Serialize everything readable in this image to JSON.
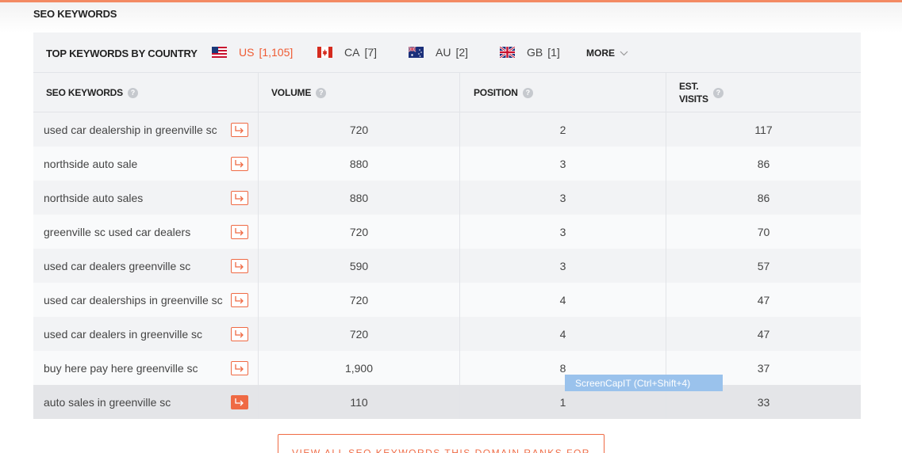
{
  "section_title": "SEO KEYWORDS",
  "country_bar": {
    "label": "TOP KEYWORDS BY COUNTRY",
    "countries": [
      {
        "code": "US",
        "count": "[1,105]",
        "flag": "us-flag-icon"
      },
      {
        "code": "CA",
        "count": "[7]",
        "flag": "ca-flag-icon"
      },
      {
        "code": "AU",
        "count": "[2]",
        "flag": "au-flag-icon"
      },
      {
        "code": "GB",
        "count": "[1]",
        "flag": "gb-flag-icon"
      }
    ],
    "more_label": "MORE"
  },
  "table": {
    "headers": {
      "keywords": "SEO KEYWORDS",
      "volume": "VOLUME",
      "position": "POSITION",
      "visits_line1": "EST.",
      "visits_line2": "VISITS",
      "help_glyph": "?"
    },
    "rows": [
      {
        "keyword": "used car dealership in greenville sc",
        "volume": "720",
        "position": "2",
        "visits": "117"
      },
      {
        "keyword": "northside auto sale",
        "volume": "880",
        "position": "3",
        "visits": "86"
      },
      {
        "keyword": "northside auto sales",
        "volume": "880",
        "position": "3",
        "visits": "86"
      },
      {
        "keyword": "greenville sc used car dealers",
        "volume": "720",
        "position": "3",
        "visits": "70"
      },
      {
        "keyword": "used car dealers greenville sc",
        "volume": "590",
        "position": "3",
        "visits": "57"
      },
      {
        "keyword": "used car dealerships in greenville sc",
        "volume": "720",
        "position": "4",
        "visits": "47"
      },
      {
        "keyword": "used car dealers in greenville sc",
        "volume": "720",
        "position": "4",
        "visits": "47"
      },
      {
        "keyword": "buy here pay here greenville sc",
        "volume": "1,900",
        "position": "8",
        "visits": "37"
      },
      {
        "keyword": "auto sales in greenville sc",
        "volume": "110",
        "position": "1",
        "visits": "33"
      }
    ]
  },
  "tooltip": "ScreenCapIT  (Ctrl+Shift+4)",
  "view_all_label": "VIEW ALL SEO KEYWORDS THIS DOMAIN RANKS FOR",
  "colors": {
    "accent": "#ef5a32",
    "button_border": "#ef6a44",
    "row_highlight": "#e4e5e8"
  }
}
